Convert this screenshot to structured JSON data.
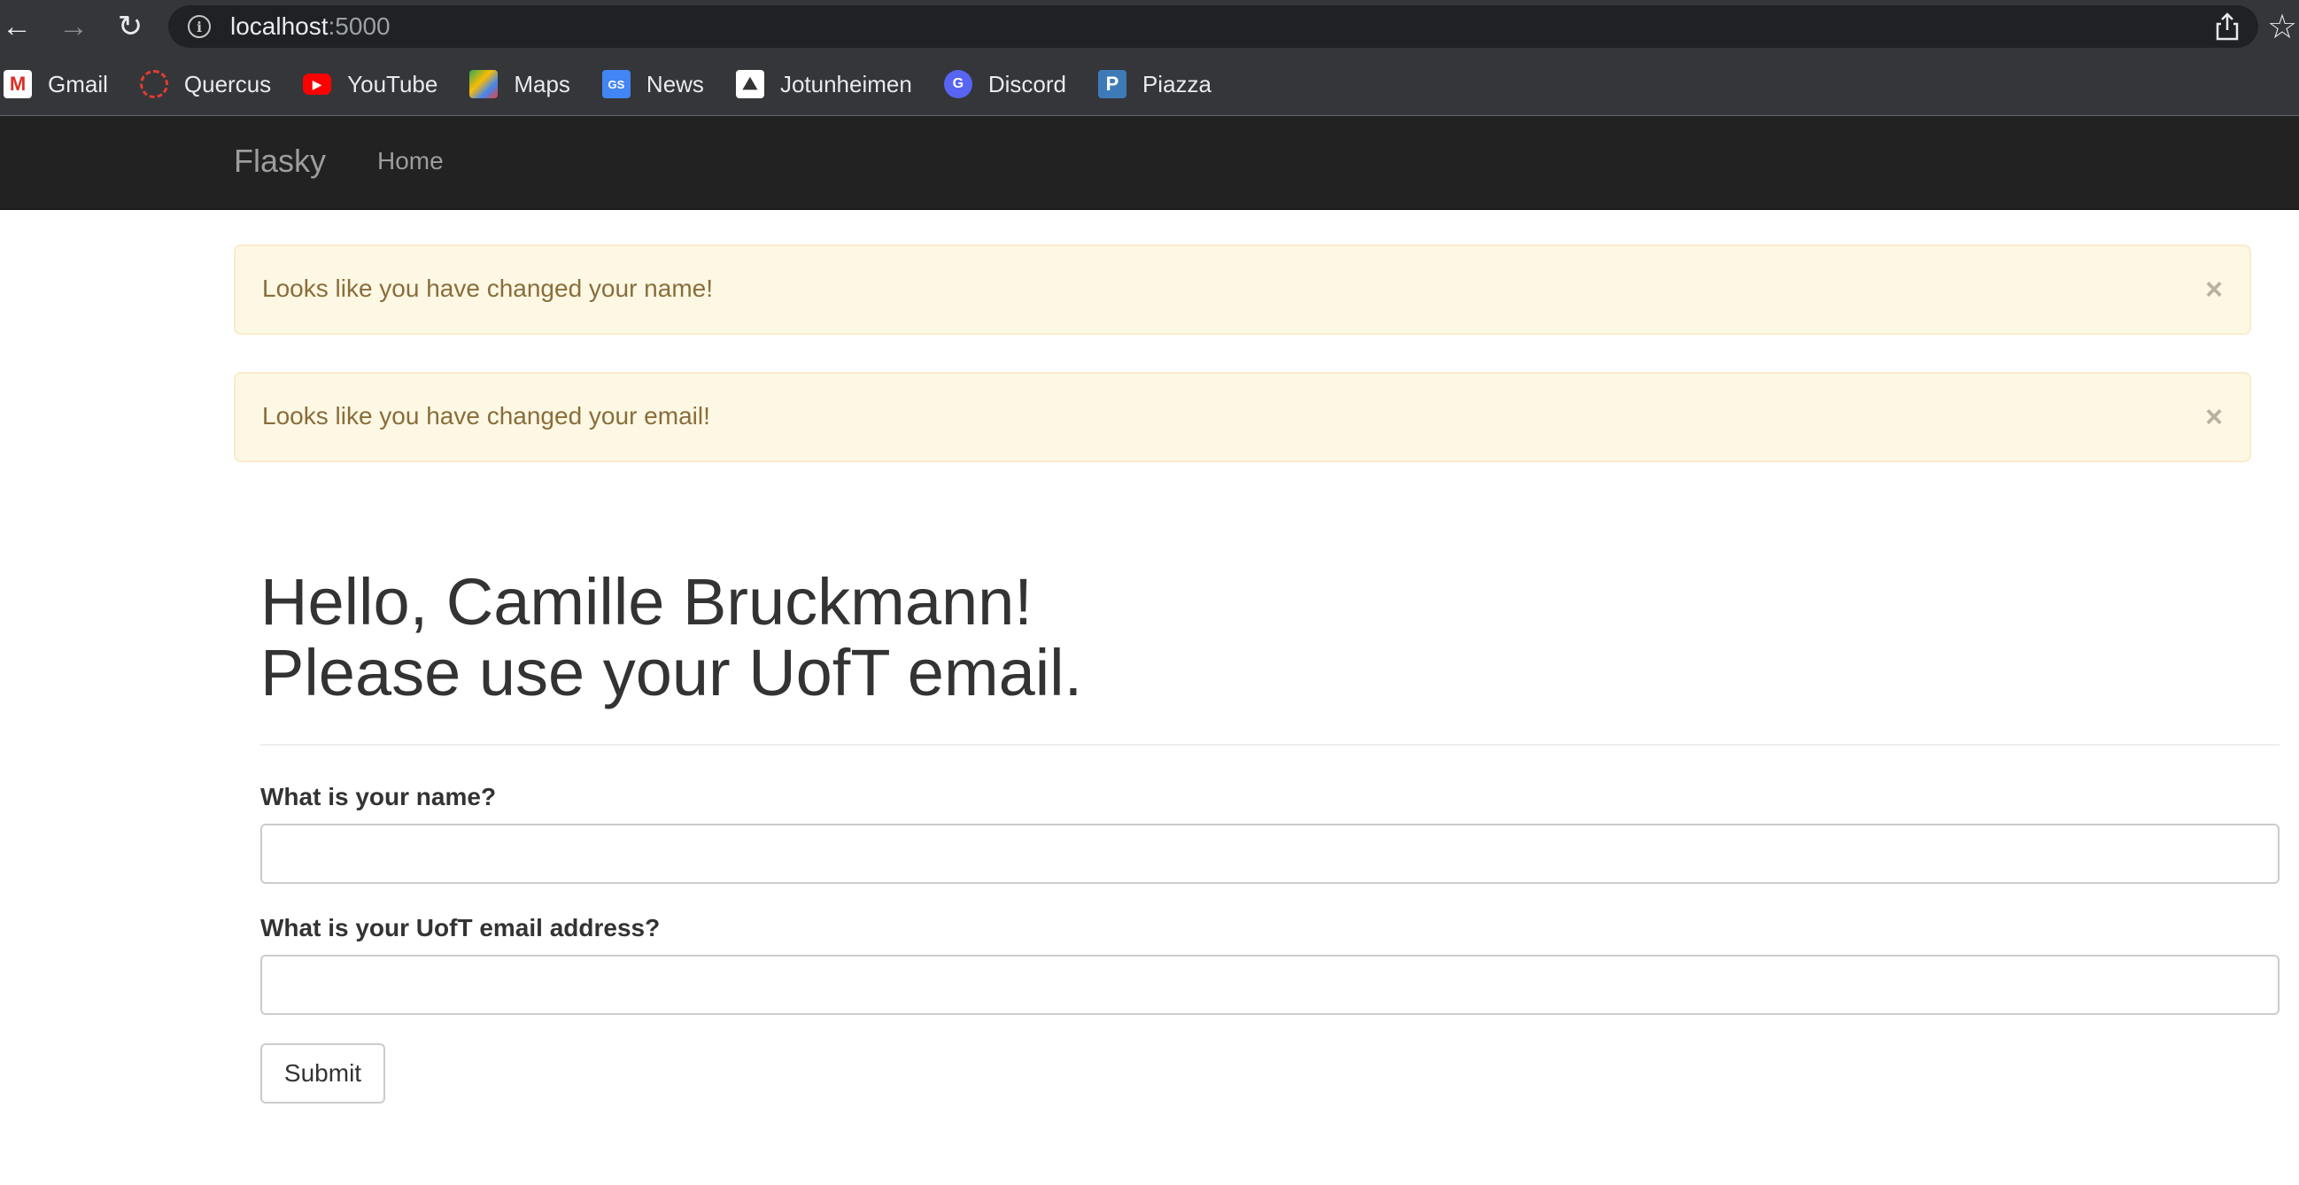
{
  "browser": {
    "url_host": "localhost",
    "url_port": ":5000",
    "bookmarks": [
      {
        "label": "Gmail",
        "icon": "gmail-icon",
        "color": "#d93025"
      },
      {
        "label": "Quercus",
        "icon": "quercus-icon",
        "color": "#e03d31"
      },
      {
        "label": "YouTube",
        "icon": "youtube-icon",
        "color": "#ff0000"
      },
      {
        "label": "Maps",
        "icon": "maps-icon",
        "color": "#34a853"
      },
      {
        "label": "News",
        "icon": "news-icon",
        "color": "#4285f4"
      },
      {
        "label": "Jotunheimen",
        "icon": "jotunheimen-icon",
        "color": "#ffffff"
      },
      {
        "label": "Discord",
        "icon": "discord-icon",
        "color": "#5865f2"
      },
      {
        "label": "Piazza",
        "icon": "piazza-icon",
        "color": "#3e7ab8"
      }
    ]
  },
  "navbar": {
    "brand": "Flasky",
    "home": "Home"
  },
  "alerts": [
    {
      "message": "Looks like you have changed your name!",
      "close": "×"
    },
    {
      "message": "Looks like you have changed your email!",
      "close": "×"
    }
  ],
  "header": {
    "line1": "Hello, Camille Bruckmann!",
    "line2": "Please use your UofT email."
  },
  "form": {
    "name_label": "What is your name?",
    "name_value": "",
    "email_label": "What is your UofT email address?",
    "email_value": "",
    "submit_label": "Submit"
  },
  "colors": {
    "navbar_bg": "#222222",
    "alert_bg": "#fcf8e3",
    "alert_text": "#8a6d3b"
  }
}
